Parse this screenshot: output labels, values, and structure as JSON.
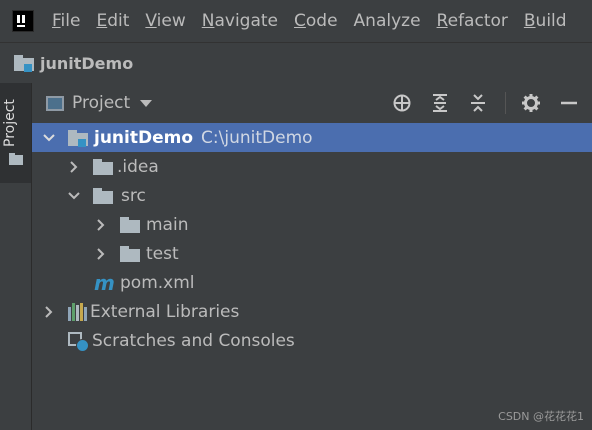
{
  "menubar": {
    "items": [
      {
        "label": "File",
        "mnemonic": "F",
        "rest": "ile"
      },
      {
        "label": "Edit",
        "mnemonic": "E",
        "rest": "dit"
      },
      {
        "label": "View",
        "mnemonic": "V",
        "rest": "iew"
      },
      {
        "label": "Navigate",
        "mnemonic": "N",
        "rest": "avigate"
      },
      {
        "label": "Code",
        "mnemonic": "C",
        "rest": "ode"
      },
      {
        "label": "Analyze",
        "mnemonic": "",
        "rest": "Analyze"
      },
      {
        "label": "Refactor",
        "mnemonic": "R",
        "rest": "efactor"
      },
      {
        "label": "Build",
        "mnemonic": "B",
        "rest": "uild"
      }
    ]
  },
  "breadcrumb": {
    "project": "junitDemo"
  },
  "toolwindow": {
    "tab_label": "Project"
  },
  "panel": {
    "title": "Project",
    "icons": [
      "locate-icon",
      "expand-all-icon",
      "collapse-all-icon",
      "settings-icon",
      "hide-icon"
    ]
  },
  "tree": {
    "root": {
      "label": "junitDemo",
      "path": "C:\\junitDemo"
    },
    "idea": ".idea",
    "src": "src",
    "main": "main",
    "test": "test",
    "pom": "pom.xml",
    "external": "External Libraries",
    "scratches": "Scratches and Consoles"
  },
  "colors": {
    "selection": "#4b6eaf",
    "background": "#3c3f41",
    "maven": "#3592c4"
  },
  "watermark": "CSDN @花花花1"
}
